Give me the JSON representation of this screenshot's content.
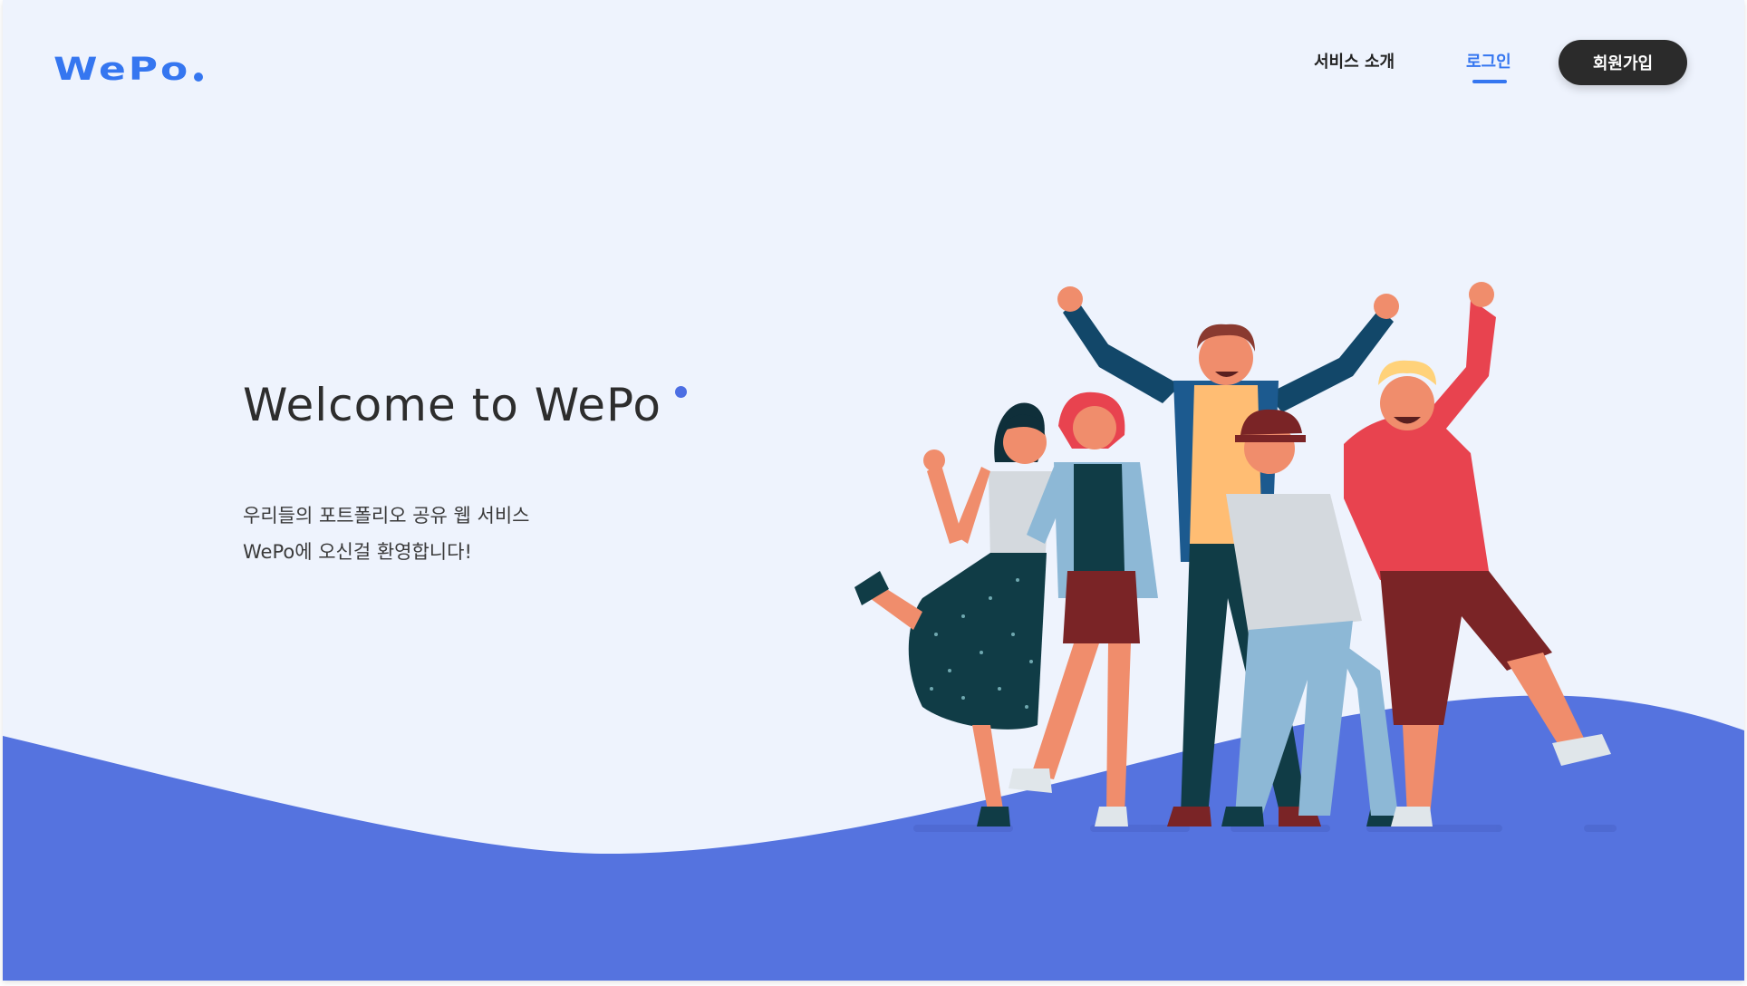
{
  "header": {
    "logo_text": "WePo",
    "nav": {
      "about_label": "서비스 소개",
      "login_label": "로그인",
      "signup_label": "회원가입"
    }
  },
  "hero": {
    "title": "Welcome to WePo",
    "subtitle_line1": "우리들의 포트폴리오 공유 웹 서비스",
    "subtitle_line2": "WePo에 오신걸 환영합니다!"
  },
  "colors": {
    "background": "#eef3fd",
    "accent": "#3576f0",
    "wave": "#5573df",
    "button_dark": "#2b2b2b",
    "title_text": "#2d2d2d"
  },
  "illustration": {
    "icon": "group-of-happy-people-illustration"
  }
}
